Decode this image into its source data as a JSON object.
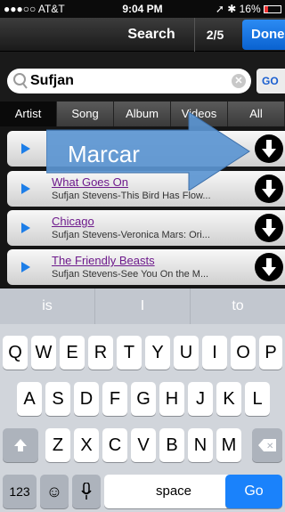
{
  "status": {
    "carrier": "●●●○○ AT&T",
    "time": "9:04 PM",
    "battery": "16%"
  },
  "nav": {
    "title": "Search",
    "page": "2/5",
    "done": "Done"
  },
  "search": {
    "value": "Sufjan",
    "go": "GO"
  },
  "tabs": [
    "Artist",
    "Song",
    "Album",
    "Videos",
    "All"
  ],
  "overlay": {
    "label": "Marcar"
  },
  "results": [
    {
      "title": "",
      "subtitle": ""
    },
    {
      "title": "What Goes On",
      "subtitle": "Sufjan Stevens-This Bird Has Flow..."
    },
    {
      "title": "Chicago",
      "subtitle": "Sufjan Stevens-Veronica Mars: Ori..."
    },
    {
      "title": "The Friendly Beasts",
      "subtitle": "Sufjan Stevens-See You On the M..."
    }
  ],
  "suggestions": [
    "is",
    "I",
    "to"
  ],
  "keyboard": {
    "row1": [
      "Q",
      "W",
      "E",
      "R",
      "T",
      "Y",
      "U",
      "I",
      "O",
      "P"
    ],
    "row2": [
      "A",
      "S",
      "D",
      "F",
      "G",
      "H",
      "J",
      "K",
      "L"
    ],
    "row3": [
      "Z",
      "X",
      "C",
      "V",
      "B",
      "N",
      "M"
    ],
    "numbers": "123",
    "space": "space",
    "go": "Go"
  },
  "colors": {
    "accent": "#1a82fb",
    "overlay": "#5b95d1"
  }
}
